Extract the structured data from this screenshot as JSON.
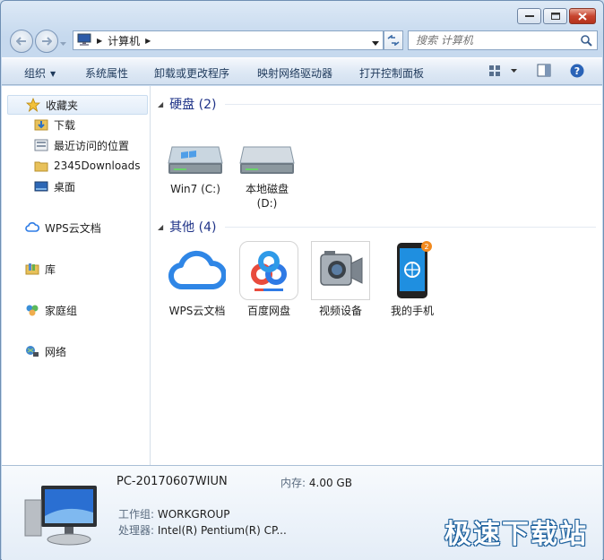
{
  "window": {
    "caption_buttons": [
      "minimize",
      "maximize",
      "close"
    ]
  },
  "address_bar": {
    "breadcrumb": "计算机",
    "search_placeholder": "搜索 计算机"
  },
  "toolbar": {
    "organize": "组织",
    "system_properties": "系统属性",
    "uninstall": "卸载或更改程序",
    "map_drive": "映射网络驱动器",
    "control_panel": "打开控制面板"
  },
  "sidebar": {
    "favorites": "收藏夹",
    "downloads": "下载",
    "recent": "最近访问的位置",
    "d2345": "2345Downloads",
    "desktop": "桌面",
    "wps_cloud": "WPS云文档",
    "library": "库",
    "homegroup": "家庭组",
    "network": "网络"
  },
  "content": {
    "group_disks": "硬盘 (2)",
    "group_other": "其他 (4)",
    "drives": [
      {
        "label": "Win7 (C:)"
      },
      {
        "label": "本地磁盘\n(D:)"
      }
    ],
    "others": [
      {
        "label": "WPS云文档"
      },
      {
        "label": "百度网盘"
      },
      {
        "label": "视频设备"
      },
      {
        "label": "我的手机"
      }
    ]
  },
  "details": {
    "pc_name": "PC-20170607WIUN",
    "memory_label": "内存:",
    "memory_value": "4.00 GB",
    "workgroup_label": "工作组:",
    "workgroup_value": "WORKGROUP",
    "cpu_label": "处理器:",
    "cpu_value": "Intel(R) Pentium(R) CP..."
  },
  "watermark": "极速下载站",
  "colors": {
    "accent": "#1e3287",
    "toolbar_text": "#1e395b"
  }
}
